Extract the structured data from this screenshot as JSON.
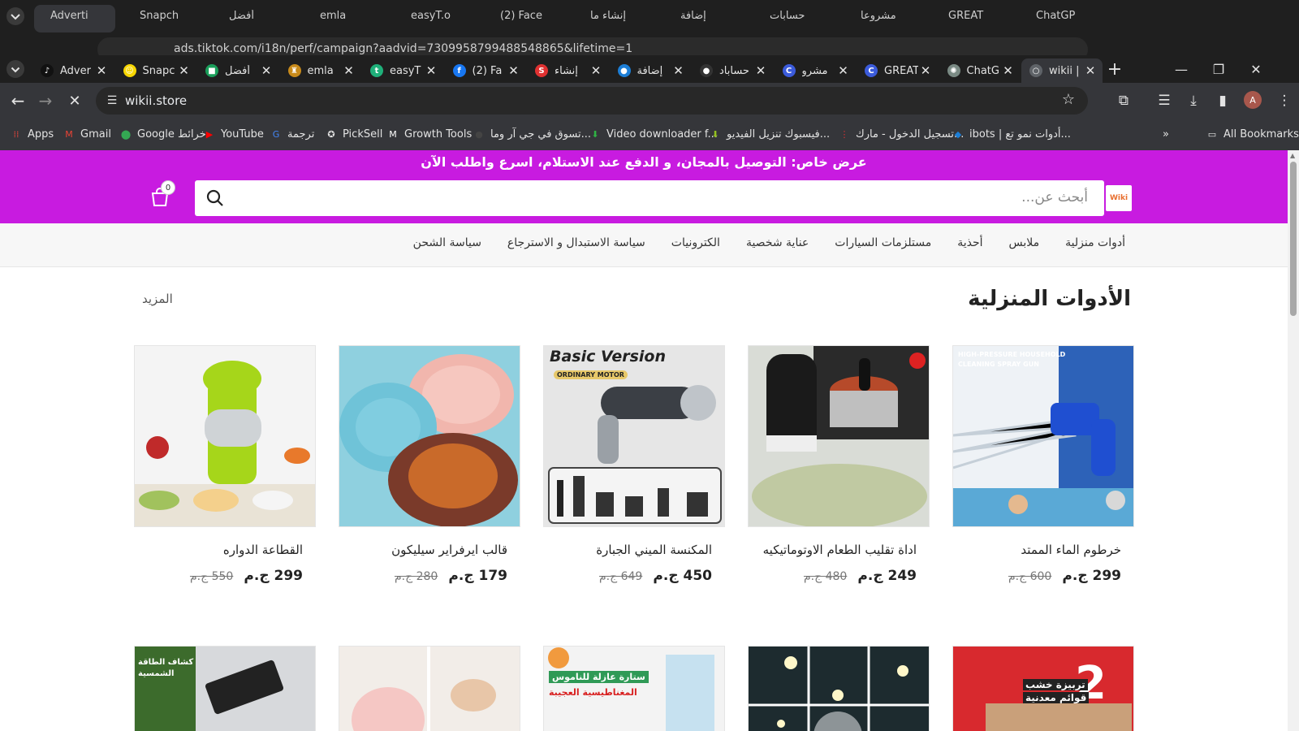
{
  "back_window": {
    "tabs": [
      "Adverti",
      "Snapch",
      "أفضل",
      "emla",
      "easyT.o",
      "(2) Face",
      "إنشاء ما",
      "إضافة",
      "حسابات",
      "مشروعا",
      "GREAT",
      "ChatGP"
    ],
    "url": "ads.tiktok.com/i18n/perf/campaign?aadvid=7309958799488548865&lifetime=1"
  },
  "tabs": [
    {
      "title": "Adver",
      "color": "#111111",
      "glyph": "♪"
    },
    {
      "title": "Snapc",
      "color": "#f7d600",
      "glyph": "☺"
    },
    {
      "title": "أفضل",
      "color": "#1a9e5a",
      "glyph": "■"
    },
    {
      "title": "emla",
      "color": "#c88a1a",
      "glyph": "♜"
    },
    {
      "title": "easyT",
      "color": "#1fb07a",
      "glyph": "t"
    },
    {
      "title": "(2) Fa",
      "color": "#1877f2",
      "glyph": "f"
    },
    {
      "title": "إنشاء",
      "color": "#e03131",
      "glyph": "S"
    },
    {
      "title": "إضافة",
      "color": "#1c7ed6",
      "glyph": "●"
    },
    {
      "title": "حساباد",
      "color": "#333333",
      "glyph": "●"
    },
    {
      "title": "مشرو",
      "color": "#3b5bdb",
      "glyph": "C"
    },
    {
      "title": "GREAT",
      "color": "#3b5bdb",
      "glyph": "C"
    },
    {
      "title": "ChatG",
      "color": "#7a8a84",
      "glyph": "✺"
    },
    {
      "title": "wikii |",
      "color": "#5f6368",
      "glyph": "○"
    }
  ],
  "toolbar": {
    "url": "wikii.store"
  },
  "bookmarks": [
    {
      "label": "Apps",
      "icon": "apps-grid-icon",
      "color": "#e8453c"
    },
    {
      "label": "Gmail",
      "icon": "gmail-icon",
      "color": "#ea4335"
    },
    {
      "label": "Google خرائط",
      "icon": "maps-pin-icon",
      "color": "#34a853"
    },
    {
      "label": "YouTube",
      "icon": "youtube-icon",
      "color": "#ff0000"
    },
    {
      "label": "ترجمة",
      "icon": "translate-icon",
      "color": "#4285f4"
    },
    {
      "label": "PickSell",
      "icon": "picksell-icon",
      "color": "#e3e3e3"
    },
    {
      "label": "Growth Tools",
      "icon": "growth-tools-icon",
      "color": "#ffffff"
    },
    {
      "label": "تسوق في جي آر وما...",
      "icon": "gr-shop-icon",
      "color": "#444444"
    },
    {
      "label": "Video downloader f...",
      "icon": "download-arrow-icon",
      "color": "#2fb344"
    },
    {
      "label": "فيسبوك تنزيل الفيديو...",
      "icon": "download-arrow-icon",
      "color": "#94c11f"
    },
    {
      "label": "تسجيل الدخول - مارك...",
      "icon": "dots-icon",
      "color": "#e03131"
    },
    {
      "label": "ibots | أدوات نمو تع...",
      "icon": "ibots-icon",
      "color": "#1c7ed6"
    }
  ],
  "all_bookmarks": "All Bookmarks",
  "avatar_letter": "A",
  "site": {
    "promo": "عرض خاص: التوصيل بالمجان، و الدفع عند الاستلام، اسرع واطلب الآن",
    "search_placeholder": "أبحث عن...",
    "logo_text": "Wiki",
    "cart_count": "0",
    "categories": [
      "أدوات منزلية",
      "ملابس",
      "أحذية",
      "مستلزمات السيارات",
      "عناية شخصية",
      "الكترونيات",
      "سياسة الاستبدال و الاسترجاع",
      "سياسة الشحن"
    ],
    "section_title": "الأدوات المنزلية",
    "more": "المزيد",
    "products": [
      {
        "name": "خرطوم الماء الممتد",
        "price": "299 ج.م",
        "old": "600 ج.م",
        "image": "spray-gun"
      },
      {
        "name": "اداة تقليب الطعام الاوتوماتيكيه",
        "price": "249 ج.م",
        "old": "480 ج.م",
        "image": "stirrer"
      },
      {
        "name": "المكنسة الميني الجبارة",
        "price": "450 ج.م",
        "old": "649 ج.م",
        "image": "vacuum",
        "image_text": "Basic Version",
        "image_subtext": "ORDINARY MOTOR"
      },
      {
        "name": "قالب ايرفراير سيليكون",
        "price": "179 ج.م",
        "old": "280 ج.م",
        "image": "air-fryer-liner"
      },
      {
        "name": "القطاعة الدواره",
        "price": "299 ج.م",
        "old": "550 ج.م",
        "image": "rotary-grater"
      }
    ],
    "spray_label_1": "HIGH-PRESSURE HOUSEHOLD",
    "spray_label_2": "CLEANING SPRAY GUN",
    "row2": [
      {
        "image": "wooden-tray",
        "text_1": "تربيزة خشب",
        "text_2": "قوائم معدنية",
        "badge": "2"
      },
      {
        "image": "ground-lights"
      },
      {
        "image": "mosquito-net",
        "text_1": "ستارة عازلة للناموس",
        "text_2": "المغناطيسية العجيبة"
      },
      {
        "image": "mini-chopper"
      },
      {
        "image": "solar-lamp",
        "text_1": "كشاف الطاقة",
        "text_2": "الشمسية"
      }
    ]
  }
}
